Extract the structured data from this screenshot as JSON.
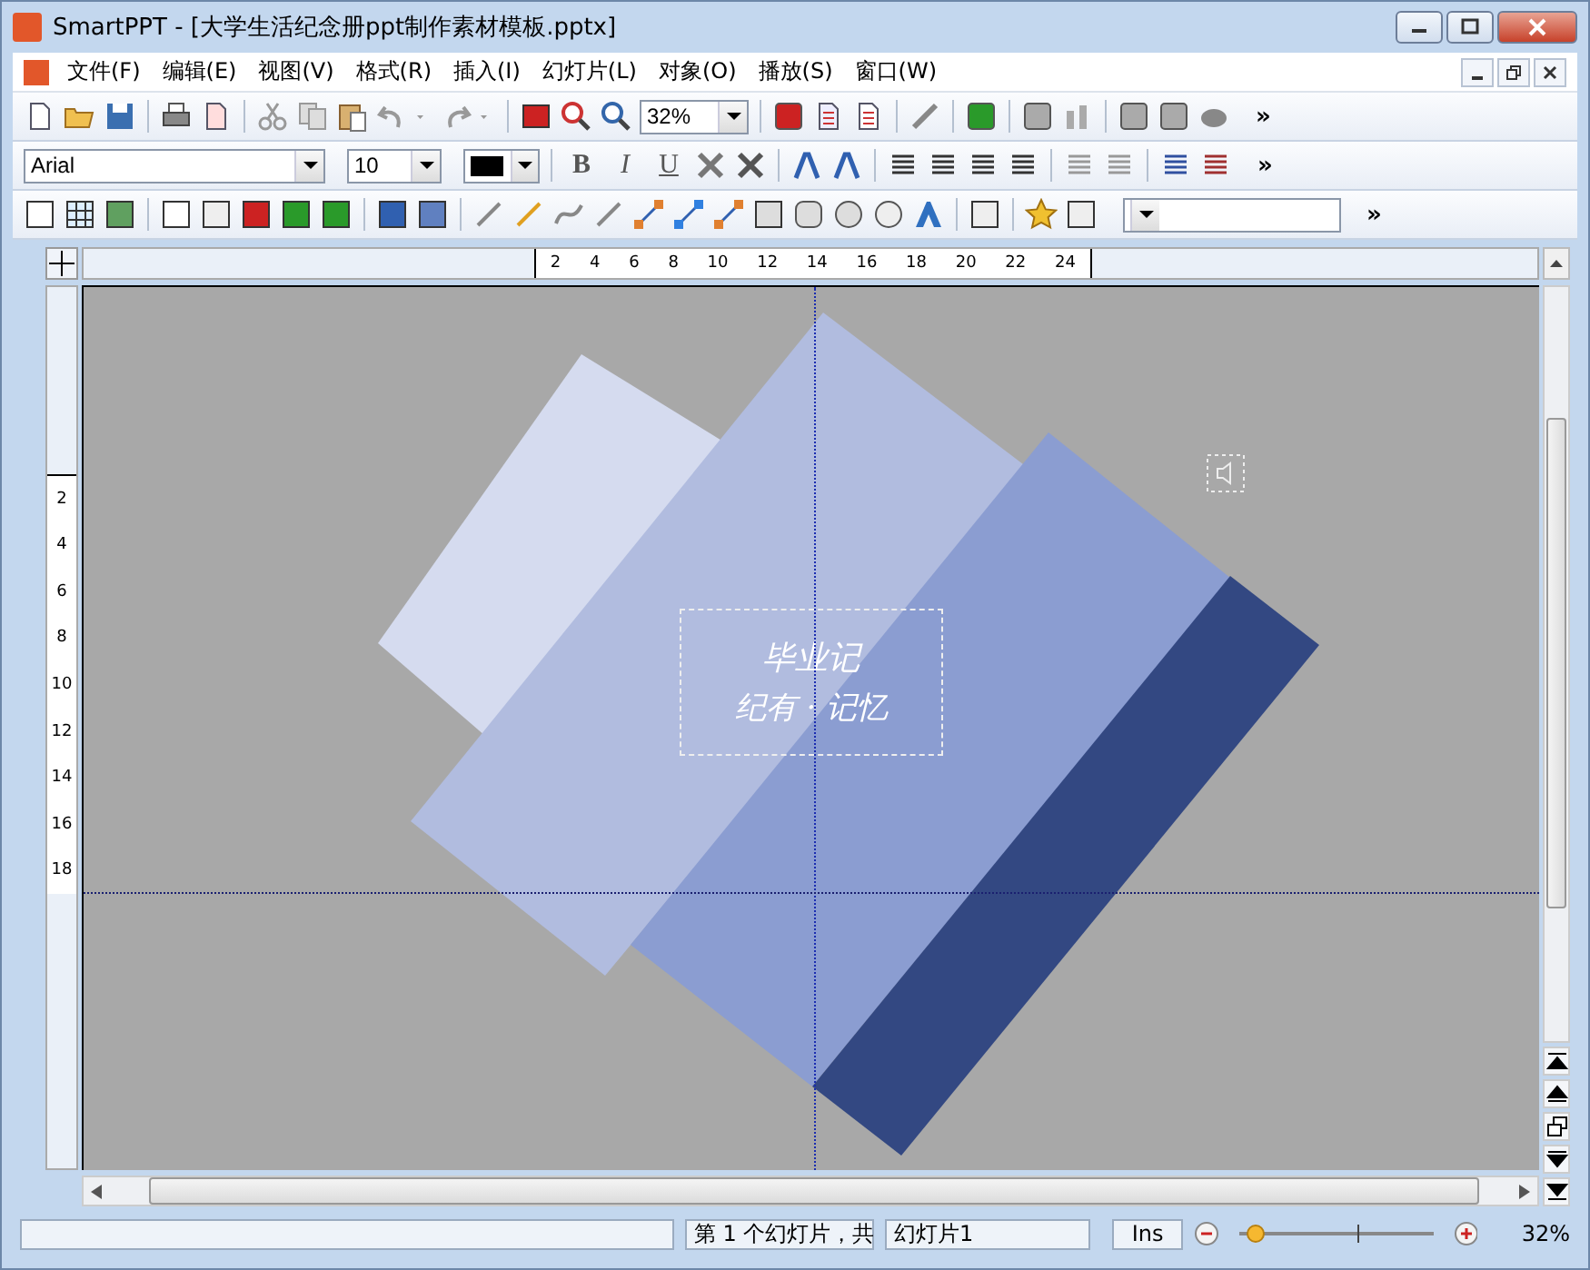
{
  "window": {
    "title": "SmartPPT - [大学生活纪念册ppt制作素材模板.pptx]"
  },
  "menu": [
    "文件(F)",
    "编辑(E)",
    "视图(V)",
    "格式(R)",
    "插入(I)",
    "幻灯片(L)",
    "对象(O)",
    "播放(S)",
    "窗口(W)"
  ],
  "toolbar": {
    "zoom": "32%",
    "font": "Arial",
    "size": "10",
    "format_buttons": [
      "B",
      "I",
      "U"
    ],
    "more": "»"
  },
  "ruler": {
    "horizontal": [
      "2",
      "4",
      "6",
      "8",
      "10",
      "12",
      "14",
      "16",
      "18",
      "20",
      "22",
      "24"
    ],
    "vertical": [
      "2",
      "4",
      "6",
      "8",
      "10",
      "12",
      "14",
      "16",
      "18"
    ]
  },
  "slide": {
    "title": "毕业记",
    "subtitle": "纪有 · 记忆"
  },
  "status_bar": {
    "position": "第 1 个幻灯片，共",
    "slide_name": "幻灯片1",
    "mode": "Ins",
    "zoom": {
      "level": 0.12
    },
    "zoom_reading": "32%"
  }
}
